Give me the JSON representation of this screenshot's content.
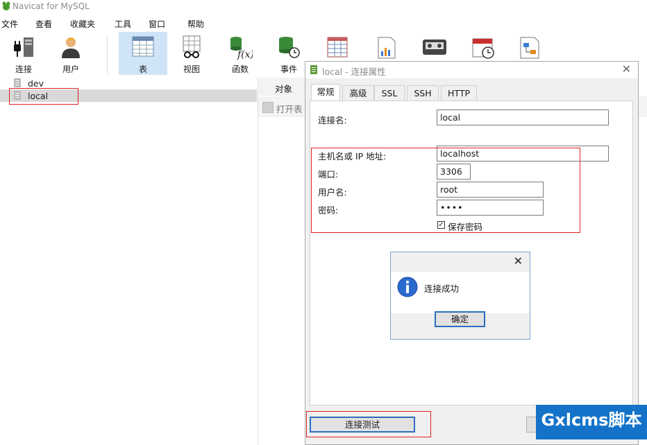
{
  "app": {
    "title": "Navicat for MySQL"
  },
  "menu": [
    "文件",
    "查看",
    "收藏夹",
    "工具",
    "窗口",
    "帮助"
  ],
  "toolbar": [
    {
      "label": "连接",
      "icon": "plug-icon"
    },
    {
      "label": "用户",
      "icon": "user-icon"
    },
    {
      "label": "表",
      "icon": "table-icon"
    },
    {
      "label": "视图",
      "icon": "view-icon"
    },
    {
      "label": "函数",
      "icon": "function-icon"
    },
    {
      "label": "事件",
      "icon": "event-icon"
    }
  ],
  "tree": [
    "dev",
    "local"
  ],
  "objects": {
    "tab_label": "对象",
    "open_table": "打开表"
  },
  "dialog": {
    "title": "local - 连接属性",
    "tabs": [
      "常规",
      "高级",
      "SSL",
      "SSH",
      "HTTP"
    ],
    "fields": {
      "conn_name_label": "连接名:",
      "conn_name_value": "local",
      "host_label": "主机名或 IP 地址:",
      "host_value": "localhost",
      "port_label": "端口:",
      "port_value": "3306",
      "user_label": "用户名:",
      "user_value": "root",
      "password_label": "密码:",
      "password_value": "••••"
    },
    "save_password_label": "保存密码",
    "test_button": "连接测试"
  },
  "message": {
    "text": "连接成功",
    "ok_button": "确定"
  },
  "watermark": "Gxlcms脚本"
}
